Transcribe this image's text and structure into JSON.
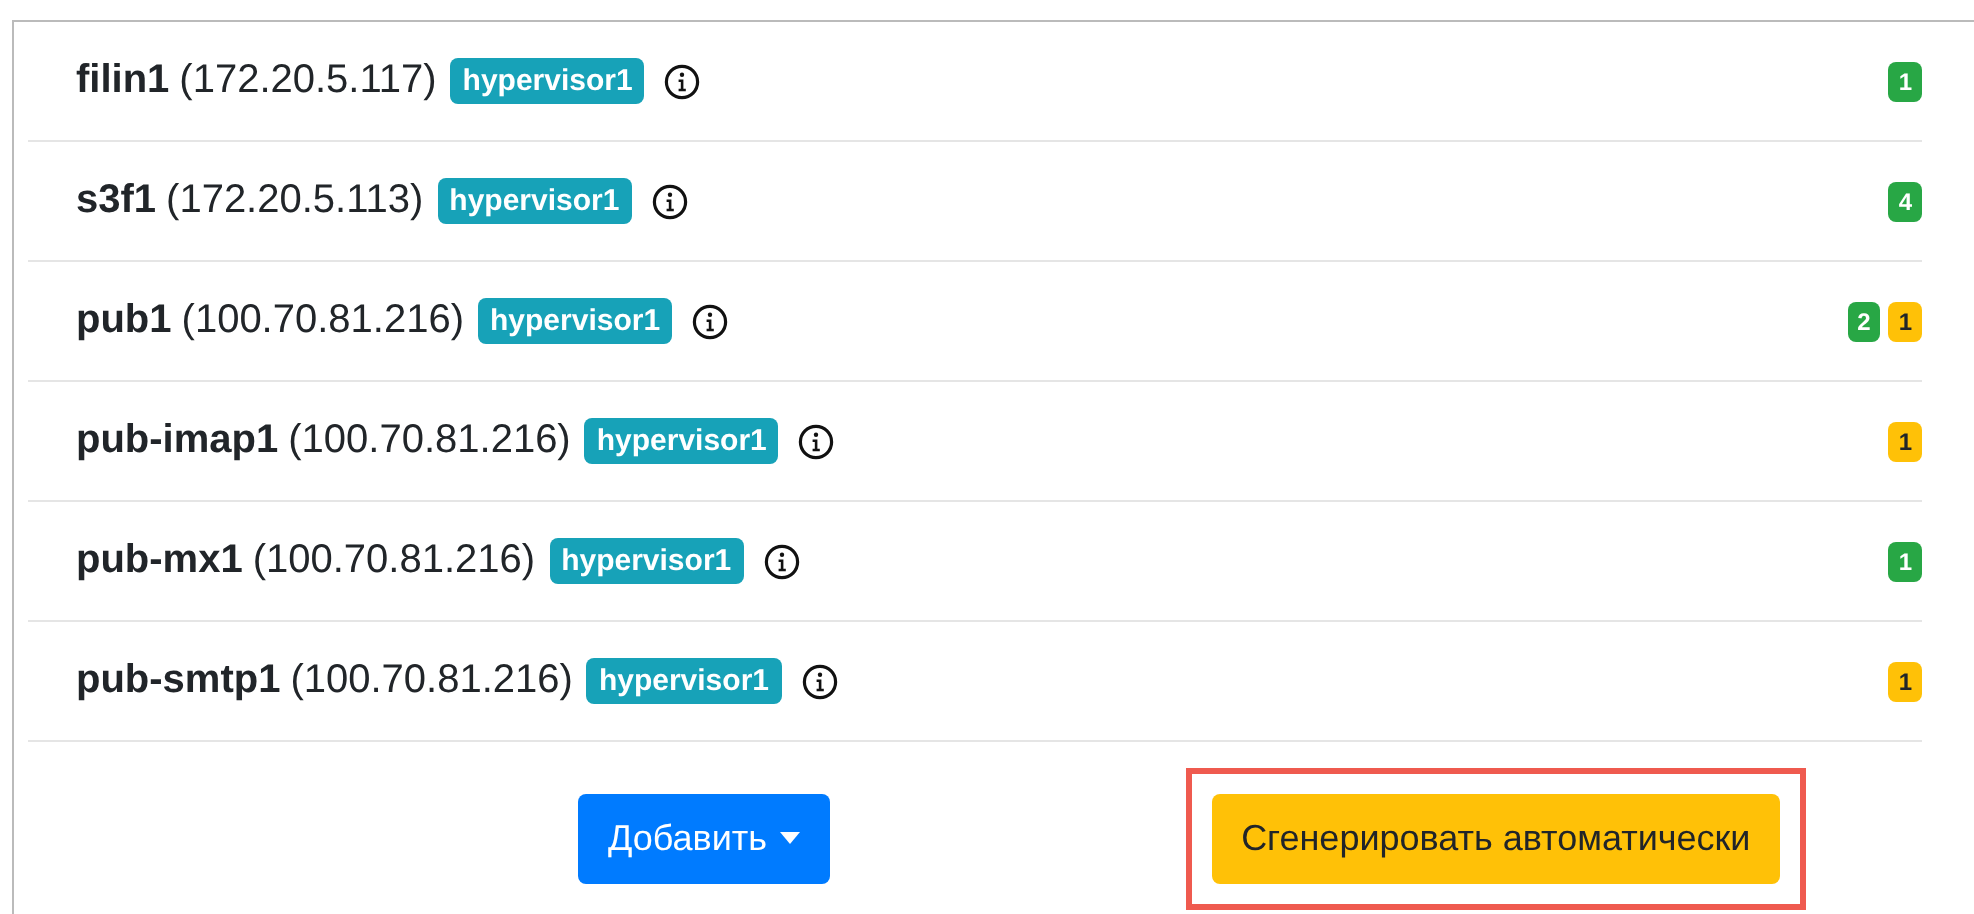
{
  "hosts": [
    {
      "name": "filin1",
      "address": "(172.20.5.117)",
      "tag": "hypervisor1",
      "counts": [
        {
          "value": "1",
          "color": "#28a745"
        }
      ]
    },
    {
      "name": "s3f1",
      "address": "(172.20.5.113)",
      "tag": "hypervisor1",
      "counts": [
        {
          "value": "4",
          "color": "#28a745"
        }
      ]
    },
    {
      "name": "pub1",
      "address": "(100.70.81.216)",
      "tag": "hypervisor1",
      "counts": [
        {
          "value": "2",
          "color": "#28a745"
        },
        {
          "value": "1",
          "color": "#ffc107"
        }
      ]
    },
    {
      "name": "pub-imap1",
      "address": "(100.70.81.216)",
      "tag": "hypervisor1",
      "counts": [
        {
          "value": "1",
          "color": "#ffc107"
        }
      ]
    },
    {
      "name": "pub-mx1",
      "address": "(100.70.81.216)",
      "tag": "hypervisor1",
      "counts": [
        {
          "value": "1",
          "color": "#28a745"
        }
      ]
    },
    {
      "name": "pub-smtp1",
      "address": "(100.70.81.216)",
      "tag": "hypervisor1",
      "counts": [
        {
          "value": "1",
          "color": "#ffc107"
        }
      ]
    }
  ],
  "actions": [
    {
      "kind": "dropdown",
      "label": "Добавить",
      "highlighted": false
    },
    {
      "kind": "primary",
      "label": "Сгенерировать автоматически",
      "highlighted": true
    }
  ]
}
